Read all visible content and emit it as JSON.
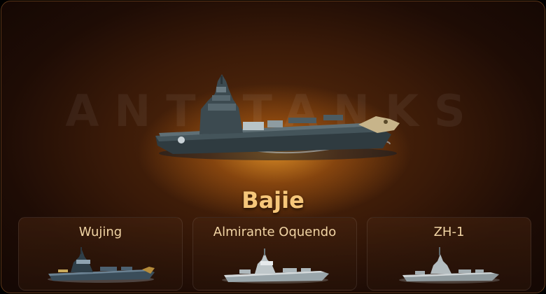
{
  "watermark": "ANTITANKS",
  "featured": {
    "name": "Bajie",
    "icon": "aircraft-carrier-ship-icon"
  },
  "variants": [
    {
      "name": "Wujing",
      "icon": "battleship-icon"
    },
    {
      "name": "Almirante Oquendo",
      "icon": "cruiser-ship-icon"
    },
    {
      "name": "ZH-1",
      "icon": "destroyer-ship-icon"
    }
  ],
  "colors": {
    "title": "#f6c77a",
    "label": "#f1d4a4",
    "glow": "#e89628",
    "background": "#1e0c05"
  }
}
